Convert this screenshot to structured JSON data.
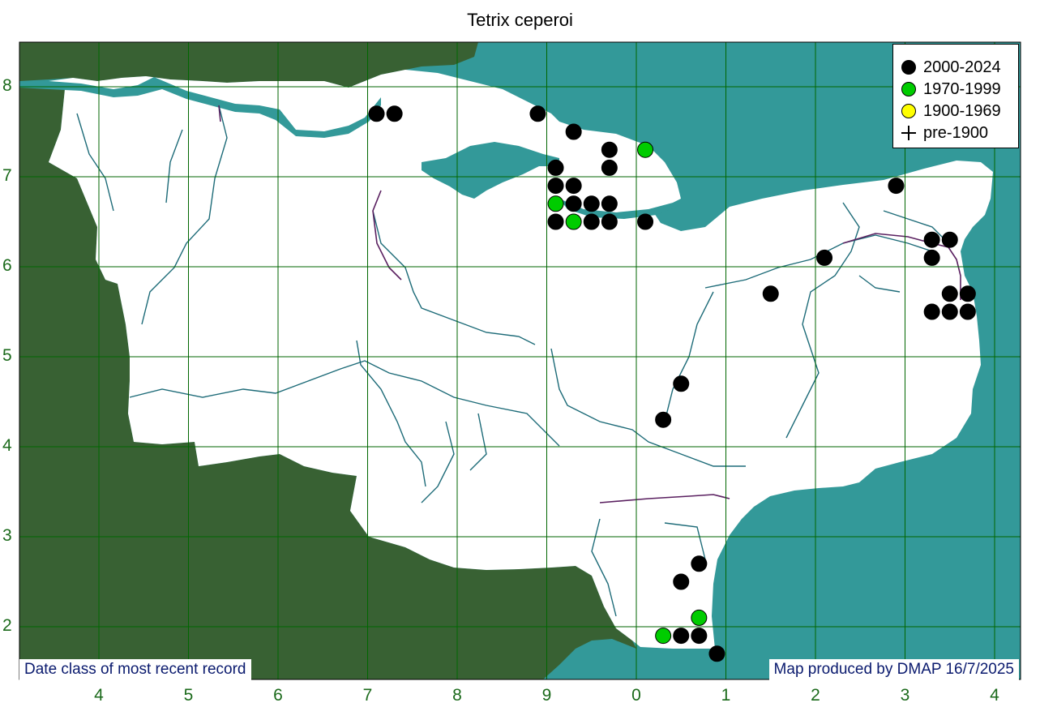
{
  "title": "Tetrix ceperoi",
  "axes": {
    "x_labels": [
      "4",
      "5",
      "6",
      "7",
      "8",
      "9",
      "0",
      "1",
      "2",
      "3",
      "4"
    ],
    "y_labels": [
      "8",
      "7",
      "6",
      "5",
      "4",
      "3",
      "2"
    ]
  },
  "legend": {
    "items": [
      {
        "label": "2000-2024",
        "color": "#000000",
        "marker": "dot"
      },
      {
        "label": "1970-1999",
        "color": "#00cc00",
        "marker": "dot"
      },
      {
        "label": "1900-1969",
        "color": "#ffff00",
        "marker": "dot"
      },
      {
        "label": "pre-1900",
        "color": "#000000",
        "marker": "plus"
      }
    ]
  },
  "footer": {
    "left": "Date class of most recent record",
    "right": "Map produced by DMAP 16/7/2025"
  },
  "colors": {
    "land_outside": "#386133",
    "sea": "#339999",
    "county": "#ffffff",
    "grid": "#006600",
    "rivers": "#1d6b78"
  },
  "records": [
    {
      "x": 7.1,
      "y": 7.7,
      "period": "2000-2024"
    },
    {
      "x": 7.3,
      "y": 7.7,
      "period": "2000-2024"
    },
    {
      "x": 8.9,
      "y": 7.7,
      "period": "2000-2024"
    },
    {
      "x": 9.3,
      "y": 7.5,
      "period": "2000-2024"
    },
    {
      "x": 9.7,
      "y": 7.3,
      "period": "2000-2024"
    },
    {
      "x": 10.1,
      "y": 7.3,
      "period": "1970-1999"
    },
    {
      "x": 9.1,
      "y": 7.1,
      "period": "2000-2024"
    },
    {
      "x": 9.7,
      "y": 7.1,
      "period": "2000-2024"
    },
    {
      "x": 9.1,
      "y": 6.9,
      "period": "2000-2024"
    },
    {
      "x": 9.3,
      "y": 6.9,
      "period": "2000-2024"
    },
    {
      "x": 9.1,
      "y": 6.7,
      "period": "1970-1999"
    },
    {
      "x": 9.3,
      "y": 6.7,
      "period": "2000-2024"
    },
    {
      "x": 9.5,
      "y": 6.7,
      "period": "2000-2024"
    },
    {
      "x": 9.7,
      "y": 6.7,
      "period": "2000-2024"
    },
    {
      "x": 9.1,
      "y": 6.5,
      "period": "2000-2024"
    },
    {
      "x": 9.3,
      "y": 6.5,
      "period": "1970-1999"
    },
    {
      "x": 9.5,
      "y": 6.5,
      "period": "2000-2024"
    },
    {
      "x": 9.7,
      "y": 6.5,
      "period": "2000-2024"
    },
    {
      "x": 10.1,
      "y": 6.5,
      "period": "2000-2024"
    },
    {
      "x": 12.9,
      "y": 6.9,
      "period": "2000-2024"
    },
    {
      "x": 13.3,
      "y": 6.3,
      "period": "2000-2024"
    },
    {
      "x": 13.5,
      "y": 6.3,
      "period": "2000-2024"
    },
    {
      "x": 12.1,
      "y": 6.1,
      "period": "2000-2024"
    },
    {
      "x": 13.3,
      "y": 6.1,
      "period": "2000-2024"
    },
    {
      "x": 11.5,
      "y": 5.7,
      "period": "2000-2024"
    },
    {
      "x": 13.5,
      "y": 5.7,
      "period": "2000-2024"
    },
    {
      "x": 13.7,
      "y": 5.7,
      "period": "2000-2024"
    },
    {
      "x": 13.3,
      "y": 5.5,
      "period": "2000-2024"
    },
    {
      "x": 13.5,
      "y": 5.5,
      "period": "2000-2024"
    },
    {
      "x": 13.7,
      "y": 5.5,
      "period": "2000-2024"
    },
    {
      "x": 10.5,
      "y": 4.7,
      "period": "2000-2024"
    },
    {
      "x": 10.3,
      "y": 4.3,
      "period": "2000-2024"
    },
    {
      "x": 10.7,
      "y": 2.7,
      "period": "2000-2024"
    },
    {
      "x": 10.5,
      "y": 2.5,
      "period": "2000-2024"
    },
    {
      "x": 10.7,
      "y": 2.1,
      "period": "1970-1999"
    },
    {
      "x": 10.3,
      "y": 1.9,
      "period": "1970-1999"
    },
    {
      "x": 10.5,
      "y": 1.9,
      "period": "2000-2024"
    },
    {
      "x": 10.7,
      "y": 1.9,
      "period": "2000-2024"
    },
    {
      "x": 10.9,
      "y": 1.7,
      "period": "2000-2024"
    }
  ]
}
